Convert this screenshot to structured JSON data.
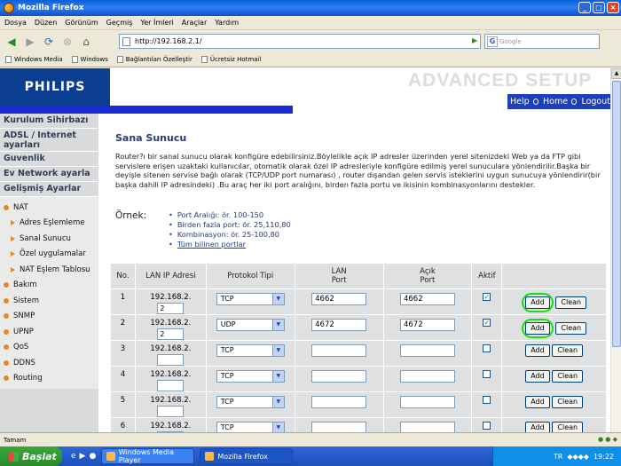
{
  "window": {
    "title": "Mozilla Firefox",
    "btn_min": "_",
    "btn_max": "□",
    "btn_close": "×"
  },
  "menu": [
    "Dosya",
    "Düzen",
    "Görünüm",
    "Geçmiş",
    "Yer İmleri",
    "Araçlar",
    "Yardım"
  ],
  "nav": {
    "url": "http://192.168.2.1/",
    "search_placeholder": "Google"
  },
  "bookmarks": [
    "Windows Media",
    "Windows",
    "Bağlantıları Özelleştir",
    "Ücretsiz Hotmail"
  ],
  "router": {
    "brand": "PHILIPS",
    "header": "ADVANCED SETUP",
    "links": {
      "help": "Help",
      "home": "Home",
      "logout": "Logout"
    },
    "sidebar": {
      "main": [
        "Kurulum Sihirbazı",
        "ADSL / Internet ayarları",
        "Guvenlik",
        "Ev Network ayarla",
        "Gelişmiş Ayarlar"
      ],
      "nat": "NAT",
      "nat_items": [
        "Adres Eşlemleme",
        "Sanal Sunucu",
        "Özel uygulamalar",
        "NAT Eşlem Tablosu"
      ],
      "other": [
        "Bakım",
        "Sistem",
        "SNMP",
        "UPNP",
        "QoS",
        "DDNS",
        "Routing"
      ]
    },
    "title": "Sana Sunucu",
    "description": "Router?ı bir sanal sunucu olarak konfigüre edebilirsiniz.Böylelikle açık IP adresler üzerinden yerel sitenizdeki Web ya da FTP gibi servislere erişen uzaktaki kullanıcılar, otomatik olarak özel IP adresleriyle konfigüre edilmiş yerel sunuculara yönlendirilir.Başka bir deyişle sitenen servise bağlı olarak (TCP/UDP port numarası) , router dışandan gelen servis isteklerini uygun sunucuya yönlendirir(bir başka dahili IP adresindeki) .Bu araç her iki port aralığını, birden fazla portu ve ikisinin kombinasyonlarını destekler.",
    "example_label": "Örnek:",
    "examples": [
      "Port Aralığı: ör. 100-150",
      "Birden fazla port: ör. 25,110,80",
      "Kombinasyon: ör. 25-100,80"
    ],
    "all_ports_link": "Tüm bilinen portlar",
    "table": {
      "headers": {
        "no": "No.",
        "ip": "LAN IP Adresi",
        "proto": "Protokol Tipi",
        "lan": "LAN\nPort",
        "pub": "Açık\nPort",
        "active": "Aktif"
      },
      "rows": [
        {
          "no": "1",
          "ip_prefix": "192.168.2.",
          "ip_last": "2",
          "proto": "TCP",
          "lan_port": "4662",
          "pub_port": "4662",
          "active": "✓",
          "add": "Add",
          "clean": "Clean"
        },
        {
          "no": "2",
          "ip_prefix": "192.168.2.",
          "ip_last": "2",
          "proto": "UDP",
          "lan_port": "4672",
          "pub_port": "4672",
          "active": "✓",
          "add": "Add",
          "clean": "Clean"
        },
        {
          "no": "3",
          "ip_prefix": "192.168.2.",
          "ip_last": "",
          "proto": "TCP",
          "lan_port": "",
          "pub_port": "",
          "active": "",
          "add": "Add",
          "clean": "Clean"
        },
        {
          "no": "4",
          "ip_prefix": "192.168.2.",
          "ip_last": "",
          "proto": "TCP",
          "lan_port": "",
          "pub_port": "",
          "active": "",
          "add": "Add",
          "clean": "Clean"
        },
        {
          "no": "5",
          "ip_prefix": "192.168.2.",
          "ip_last": "",
          "proto": "TCP",
          "lan_port": "",
          "pub_port": "",
          "active": "",
          "add": "Add",
          "clean": "Clean"
        },
        {
          "no": "6",
          "ip_prefix": "192.168.2.",
          "ip_last": "",
          "proto": "TCP",
          "lan_port": "",
          "pub_port": "",
          "active": "",
          "add": "Add",
          "clean": "Clean"
        }
      ]
    }
  },
  "status": {
    "text": "Tamam"
  },
  "taskbar": {
    "start": "Başlat",
    "tasks": [
      "Windows Media Player",
      "Mozilla Firefox"
    ],
    "lang": "TR",
    "clock": "19:22"
  }
}
